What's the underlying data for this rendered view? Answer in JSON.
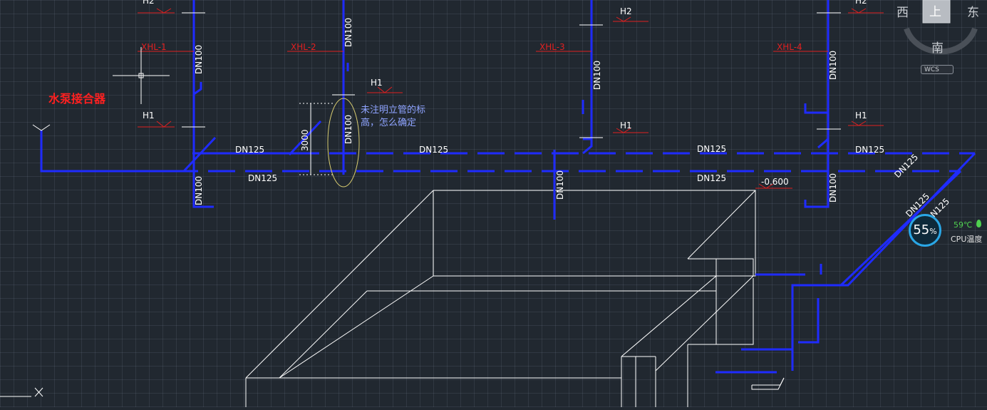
{
  "drawing": {
    "pump_connector_label": "水泵接合器",
    "annotation": {
      "line1": "未注明立管的标",
      "line2": "高，怎么确定"
    },
    "risers": [
      "XHL-1",
      "XHL-2",
      "XHL-3",
      "XHL-4"
    ],
    "level_labels": {
      "h1": "H1",
      "h2": "H2"
    },
    "pipe_sizes": {
      "dn100": "DN100",
      "dn125": "DN125"
    },
    "dimension": "3000",
    "elevation": "-0.600"
  },
  "viewcube": {
    "west": "西",
    "top": "上",
    "east": "东",
    "south": "南",
    "wcs": "WCS"
  },
  "cpu_widget": {
    "usage": "55",
    "unit": "%",
    "temp": "59℃",
    "label": "CPU温度"
  },
  "colors": {
    "background": "#212830",
    "pipe": "#1f2bff",
    "label_red": "#e02020",
    "line_white": "#ffffff"
  }
}
